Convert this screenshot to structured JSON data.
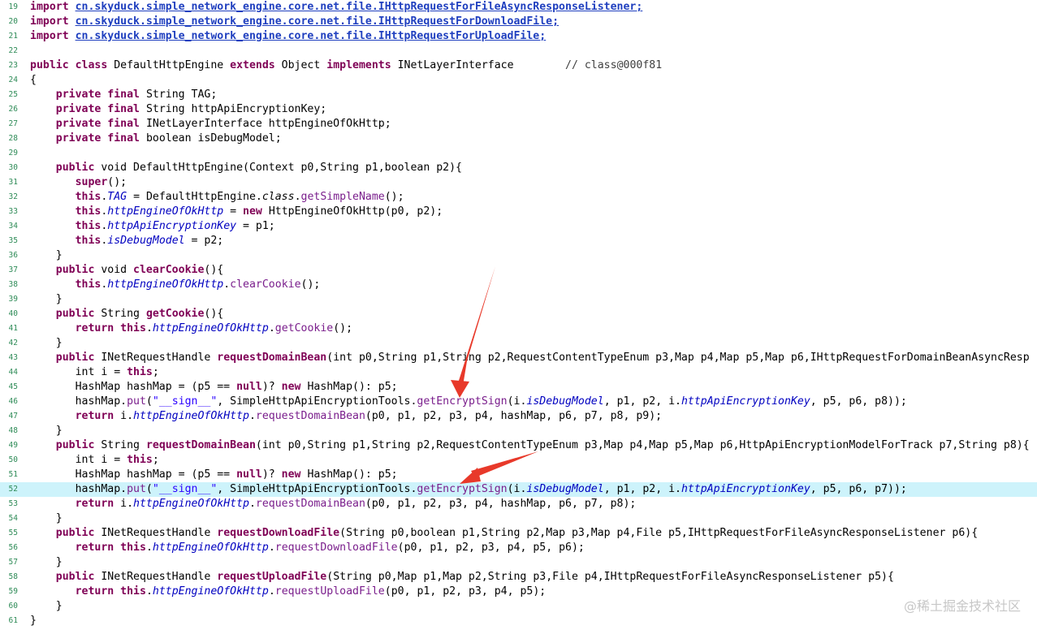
{
  "lines": [
    {
      "n": "19",
      "html": "<span class=\"kw\">import</span> <span class=\"imp\">cn.skyduck.simple_network_engine.core.net.file.IHttpRequestForFileAsyncResponseListener;</span>"
    },
    {
      "n": "20",
      "html": "<span class=\"kw\">import</span> <span class=\"imp\">cn.skyduck.simple_network_engine.core.net.file.IHttpRequestForDownloadFile;</span>"
    },
    {
      "n": "21",
      "html": "<span class=\"kw\">import</span> <span class=\"imp\">cn.skyduck.simple_network_engine.core.net.file.IHttpRequestForUploadFile;</span>"
    },
    {
      "n": "22",
      "html": ""
    },
    {
      "n": "23",
      "html": "<span class=\"kw\">public</span> <span class=\"kw\">class</span> DefaultHttpEngine <span class=\"kw\">extends</span> Object <span class=\"kw\">implements</span> INetLayerInterface        <span class=\"cmt\">// class@000f81</span>"
    },
    {
      "n": "24",
      "html": "{"
    },
    {
      "n": "25",
      "html": "    <span class=\"kw\">private</span> <span class=\"kw\">final</span> String TAG;"
    },
    {
      "n": "26",
      "html": "    <span class=\"kw\">private</span> <span class=\"kw\">final</span> String httpApiEncryptionKey;"
    },
    {
      "n": "27",
      "html": "    <span class=\"kw\">private</span> <span class=\"kw\">final</span> INetLayerInterface httpEngineOfOkHttp;"
    },
    {
      "n": "28",
      "html": "    <span class=\"kw\">private</span> <span class=\"kw\">final</span> boolean isDebugModel;"
    },
    {
      "n": "29",
      "html": ""
    },
    {
      "n": "30",
      "html": "    <span class=\"kw\">public</span> void DefaultHttpEngine(Context p0,String p1,boolean p2){"
    },
    {
      "n": "31",
      "html": "       <span class=\"kw\">super</span>();"
    },
    {
      "n": "32",
      "html": "       <span class=\"kw\">this</span>.<span class=\"fld\">TAG</span> = DefaultHttpEngine.<i>class</i>.<span class=\"call\">getSimpleName</span>();"
    },
    {
      "n": "33",
      "html": "       <span class=\"kw\">this</span>.<span class=\"fld\">httpEngineOfOkHttp</span> = <span class=\"kw\">new</span> HttpEngineOfOkHttp(p0, p2);"
    },
    {
      "n": "34",
      "html": "       <span class=\"kw\">this</span>.<span class=\"fld\">httpApiEncryptionKey</span> = p1;"
    },
    {
      "n": "35",
      "html": "       <span class=\"kw\">this</span>.<span class=\"fld\">isDebugModel</span> = p2;"
    },
    {
      "n": "36",
      "html": "    }"
    },
    {
      "n": "37",
      "html": "    <span class=\"kw\">public</span> void <span class=\"mthb\">clearCookie</span>(){"
    },
    {
      "n": "38",
      "html": "       <span class=\"kw\">this</span>.<span class=\"fld\">httpEngineOfOkHttp</span>.<span class=\"call\">clearCookie</span>();"
    },
    {
      "n": "39",
      "html": "    }"
    },
    {
      "n": "40",
      "html": "    <span class=\"kw\">public</span> String <span class=\"mthb\">getCookie</span>(){"
    },
    {
      "n": "41",
      "html": "       <span class=\"kw\">return</span> <span class=\"kw\">this</span>.<span class=\"fld\">httpEngineOfOkHttp</span>.<span class=\"call\">getCookie</span>();"
    },
    {
      "n": "42",
      "html": "    }"
    },
    {
      "n": "43",
      "html": "    <span class=\"kw\">public</span> INetRequestHandle <span class=\"mthb\">requestDomainBean</span>(int p0,String p1,String p2,RequestContentTypeEnum p3,Map p4,Map p5,Map p6,IHttpRequestForDomainBeanAsyncResp"
    },
    {
      "n": "44",
      "html": "       int i = <span class=\"kw\">this</span>;"
    },
    {
      "n": "45",
      "html": "       HashMap hashMap = (p5 == <span class=\"kw\">null</span>)? <span class=\"kw\">new</span> HashMap(): p5;"
    },
    {
      "n": "46",
      "html": "       hashMap.<span class=\"call\">put</span>(<span class=\"str\">\"__sign__\"</span>, SimpleHttpApiEncryptionTools.<span class=\"call\">getEncryptSign</span>(i.<span class=\"fld\">isDebugModel</span>, p1, p2, i.<span class=\"fld\">httpApiEncryptionKey</span>, p5, p6, p8));"
    },
    {
      "n": "47",
      "html": "       <span class=\"kw\">return</span> i.<span class=\"fld\">httpEngineOfOkHttp</span>.<span class=\"call\">requestDomainBean</span>(p0, p1, p2, p3, p4, hashMap, p6, p7, p8, p9);"
    },
    {
      "n": "48",
      "html": "    }"
    },
    {
      "n": "49",
      "html": "    <span class=\"kw\">public</span> String <span class=\"mthb\">requestDomainBean</span>(int p0,String p1,String p2,RequestContentTypeEnum p3,Map p4,Map p5,Map p6,HttpApiEncryptionModelForTrack p7,String p8){"
    },
    {
      "n": "50",
      "html": "       int i = <span class=\"kw\">this</span>;"
    },
    {
      "n": "51",
      "html": "       HashMap hashMap = (p5 == <span class=\"kw\">null</span>)? <span class=\"kw\">new</span> HashMap(): p5;"
    },
    {
      "n": "52",
      "hl": true,
      "html": "       hashMap.<span class=\"call\">put</span>(<span class=\"str\">\"__sign__\"</span>, SimpleHttpApiEncryptionTools.<span class=\"call\">getEncryptSign</span>(i.<span class=\"fld\">isDebugModel</span>, p1, p2, i.<span class=\"fld\">httpApiEncryptionKey</span>, p5, p6, p7));"
    },
    {
      "n": "53",
      "html": "       <span class=\"kw\">return</span> i.<span class=\"fld\">httpEngineOfOkHttp</span>.<span class=\"call\">requestDomainBean</span>(p0, p1, p2, p3, p4, hashMap, p6, p7, p8);"
    },
    {
      "n": "54",
      "html": "    }"
    },
    {
      "n": "55",
      "html": "    <span class=\"kw\">public</span> INetRequestHandle <span class=\"mthb\">requestDownloadFile</span>(String p0,boolean p1,String p2,Map p3,Map p4,File p5,IHttpRequestForFileAsyncResponseListener p6){"
    },
    {
      "n": "56",
      "html": "       <span class=\"kw\">return</span> <span class=\"kw\">this</span>.<span class=\"fld\">httpEngineOfOkHttp</span>.<span class=\"call\">requestDownloadFile</span>(p0, p1, p2, p3, p4, p5, p6);"
    },
    {
      "n": "57",
      "html": "    }"
    },
    {
      "n": "58",
      "html": "    <span class=\"kw\">public</span> INetRequestHandle <span class=\"mthb\">requestUploadFile</span>(String p0,Map p1,Map p2,String p3,File p4,IHttpRequestForFileAsyncResponseListener p5){"
    },
    {
      "n": "59",
      "html": "       <span class=\"kw\">return</span> <span class=\"kw\">this</span>.<span class=\"fld\">httpEngineOfOkHttp</span>.<span class=\"call\">requestUploadFile</span>(p0, p1, p2, p3, p4, p5);"
    },
    {
      "n": "60",
      "html": "    }"
    },
    {
      "n": "61",
      "html": "}"
    }
  ],
  "watermark": "@稀土掘金技术社区",
  "colors": {
    "highlight": "#cdf3fb",
    "arrow": "#e8392a"
  }
}
